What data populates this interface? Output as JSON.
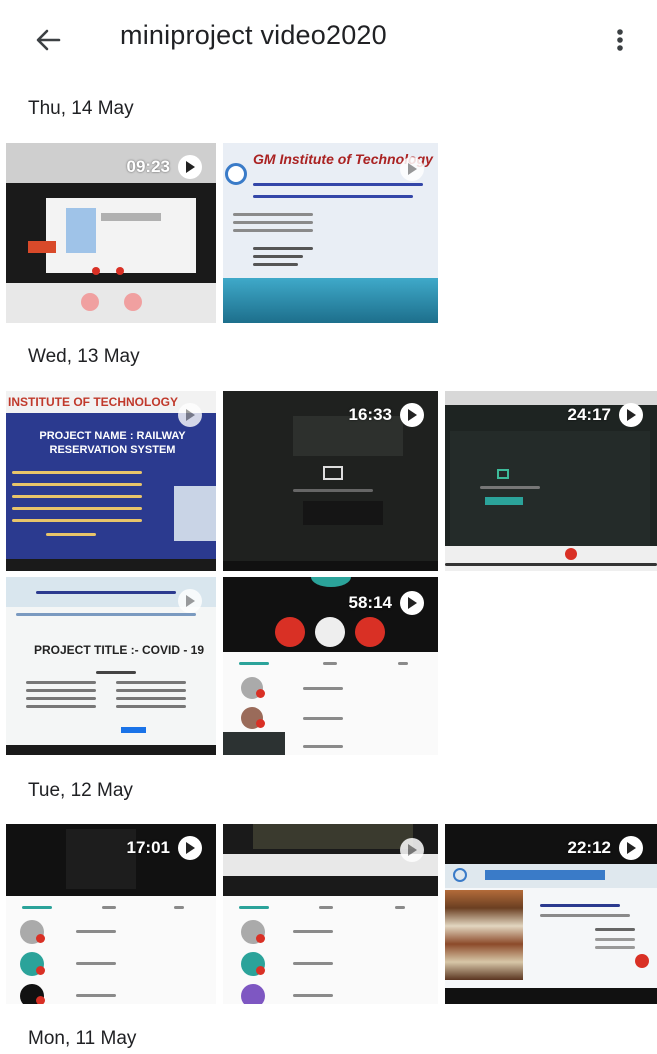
{
  "header": {
    "title": "miniproject video2020",
    "back_icon": "arrow-back-icon",
    "menu_icon": "more-vert-icon"
  },
  "sections": [
    {
      "date": "Thu, 14 May",
      "videos": [
        {
          "duration": "09:23"
        },
        {
          "duration": ""
        }
      ]
    },
    {
      "date": "Wed, 13 May",
      "videos": [
        {
          "duration": ""
        },
        {
          "duration": "16:33"
        },
        {
          "duration": "24:17"
        },
        {
          "duration": ""
        },
        {
          "duration": "58:14"
        }
      ]
    },
    {
      "date": "Tue, 12 May",
      "videos": [
        {
          "duration": "17:01"
        },
        {
          "duration": ""
        },
        {
          "duration": "22:12"
        }
      ]
    },
    {
      "date": "Mon, 11 May",
      "videos": []
    }
  ],
  "thumb_text": {
    "t1_title": "GM Institute of Technology",
    "t3_title": "INSTITUTE OF TECHNOLOGY",
    "t3_sub": "PROJECT NAME : RAILWAY RESERVATION SYSTEM",
    "t6_title": "PROJECT TITLE :- COVID - 19"
  },
  "colors": {
    "accent_red": "#d93025",
    "slide_blue": "#2b3a8f",
    "teal": "#2ba39a"
  }
}
